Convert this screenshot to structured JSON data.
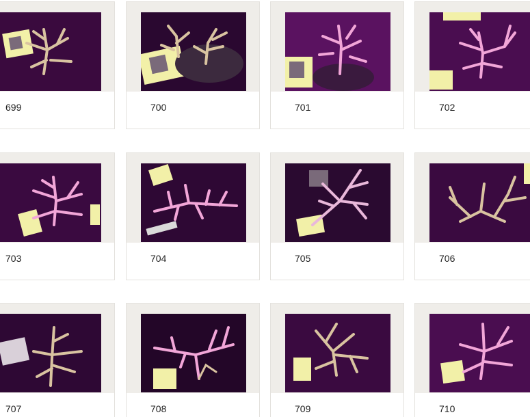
{
  "gallery": {
    "items": [
      {
        "number": "699",
        "photo_icon": "coral-frag-photo"
      },
      {
        "number": "700",
        "photo_icon": "coral-frag-photo"
      },
      {
        "number": "701",
        "photo_icon": "coral-frag-photo"
      },
      {
        "number": "702",
        "photo_icon": "coral-frag-photo"
      },
      {
        "number": "703",
        "photo_icon": "coral-frag-photo"
      },
      {
        "number": "704",
        "photo_icon": "coral-frag-photo"
      },
      {
        "number": "705",
        "photo_icon": "coral-frag-photo"
      },
      {
        "number": "706",
        "photo_icon": "coral-frag-photo"
      },
      {
        "number": "707",
        "photo_icon": "coral-frag-photo"
      },
      {
        "number": "708",
        "photo_icon": "coral-frag-photo"
      },
      {
        "number": "709",
        "photo_icon": "coral-frag-photo"
      },
      {
        "number": "710",
        "photo_icon": "coral-frag-photo"
      }
    ]
  },
  "colors": {
    "frame": "#efede9",
    "card_border": "#e3e1dd",
    "photo_bg": "#4a0d4c",
    "coral_pink": "#f2a6d8",
    "coral_tan": "#d9c3a0",
    "qr_tag": "#f2f0a8"
  }
}
